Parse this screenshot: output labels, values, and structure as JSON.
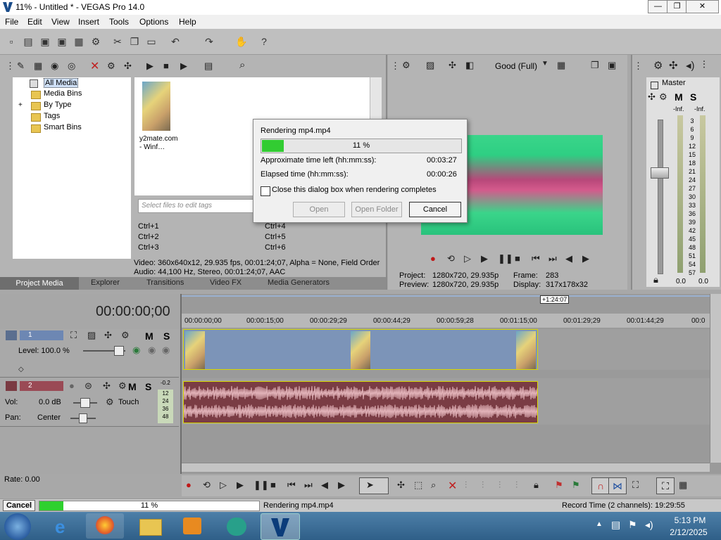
{
  "window": {
    "title": "11% - Untitled * - VEGAS Pro 14.0",
    "minimize": "—",
    "restore": "❐",
    "close": "✕"
  },
  "menu": [
    "File",
    "Edit",
    "View",
    "Insert",
    "Tools",
    "Options",
    "Help"
  ],
  "project_media": {
    "tree": [
      "All Media",
      "Media Bins",
      "By Type",
      "Tags",
      "Smart Bins"
    ],
    "tree_expander": "+",
    "file_name": "y2mate.com - Winf…",
    "tag_placeholder": "Select files to edit tags",
    "shortcuts": [
      "Ctrl+1",
      "Ctrl+2",
      "Ctrl+3",
      "Ctrl+4",
      "Ctrl+5",
      "Ctrl+6"
    ],
    "info_video": "Video: 360x640x12, 29.935 fps, 00:01:24;07, Alpha = None, Field Order",
    "info_audio": "Audio: 44,100 Hz, Stereo, 00:01:24;07, AAC",
    "tabs": [
      "Project Media",
      "Explorer",
      "Transitions",
      "Video FX",
      "Media Generators"
    ]
  },
  "preview": {
    "quality": "Good (Full)",
    "project_label": "Project:",
    "project_value": "1280x720, 29.935p",
    "preview_label": "Preview:",
    "preview_value": "1280x720, 29.935p",
    "frame_label": "Frame:",
    "frame_value": "283",
    "display_label": "Display:",
    "display_value": "317x178x32"
  },
  "mixer": {
    "master_label": "Master",
    "m_label": "M",
    "s_label": "S",
    "inf_left": "-Inf.",
    "inf_right": "-Inf.",
    "scale": [
      "3",
      "6",
      "9",
      "12",
      "15",
      "18",
      "21",
      "24",
      "27",
      "30",
      "33",
      "36",
      "39",
      "42",
      "45",
      "48",
      "51",
      "54",
      "57"
    ],
    "level_left": "0.0",
    "level_right": "0.0"
  },
  "dialog": {
    "title": "Rendering mp4.mp4",
    "progress": 0.11,
    "progress_text": "11 %",
    "approx_label": "Approximate time left (hh:mm:ss):",
    "approx_value": "00:03:27",
    "elapsed_label": "Elapsed time (hh:mm:ss):",
    "elapsed_value": "00:00:26",
    "checkbox_label": "Close this dialog box when rendering completes",
    "btn_open": "Open",
    "btn_open_folder": "Open Folder",
    "btn_cancel": "Cancel"
  },
  "timeline": {
    "timecode": "00:00:00;00",
    "length_marker": "+1:24:07",
    "ruler": [
      "00:00:00;00",
      "00:00:15;00",
      "00:00:29;29",
      "00:00:44;29",
      "00:00:59;28",
      "00:01:15;00",
      "00:01:29;29",
      "00:01:44;29",
      "00:0"
    ],
    "video_track": {
      "number": "1",
      "level_label": "Level: 100.0 %",
      "m": "M",
      "s": "S"
    },
    "audio_track": {
      "number": "2",
      "vol_label": "Vol:",
      "vol_value": "0.0 dB",
      "touch_label": "Touch",
      "pan_label": "Pan:",
      "pan_value": "Center",
      "m": "M",
      "s": "S",
      "meter_top": "-0.2",
      "meter_scale": [
        "12",
        "24",
        "36",
        "48"
      ]
    },
    "rate": "Rate: 0.00"
  },
  "status": {
    "cancel": "Cancel",
    "progress": 0.11,
    "progress_text": "11 %",
    "rendering": "Rendering mp4.mp4",
    "record_time": "Record Time (2 channels): 19:29:55"
  },
  "taskbar": {
    "time": "5:13 PM",
    "date": "2/12/2025"
  }
}
